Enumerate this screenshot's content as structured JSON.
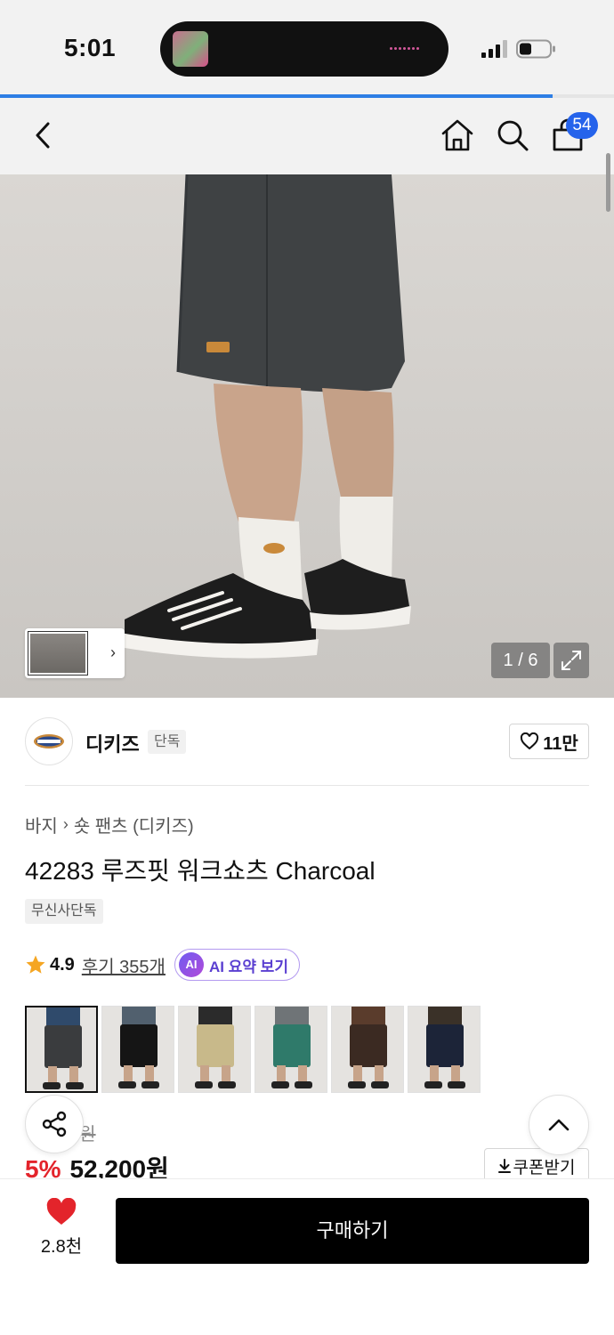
{
  "status": {
    "time": "5:01"
  },
  "cart": {
    "badge": "54"
  },
  "gallery": {
    "counter": "1 / 6"
  },
  "brand": {
    "name": "디키즈",
    "tag": "단독",
    "likes": "11만"
  },
  "breadcrumb": {
    "category": "바지",
    "subcategory": "숏 팬츠 (디키즈)"
  },
  "product": {
    "title": "42283 루즈핏 워크쇼츠 Charcoal",
    "exclusive_tag": "무신사단독",
    "rating": "4.9",
    "reviews": "후기 355개",
    "ai_badge": "AI",
    "ai_summary": "AI 요약 보기",
    "original_price_fragment": "원",
    "discount": "5%",
    "price": "52,200원",
    "coupon": "쿠폰받기"
  },
  "color_options": [
    {
      "name": "charcoal",
      "color": "#3a3c3e",
      "top": "#2f4a6b",
      "selected": true
    },
    {
      "name": "black",
      "color": "#151515",
      "top": "#51606e",
      "selected": false
    },
    {
      "name": "khaki",
      "color": "#c8b98a",
      "top": "#2b2b2b",
      "selected": false
    },
    {
      "name": "green",
      "color": "#2f7a6a",
      "top": "#6f7477",
      "selected": false
    },
    {
      "name": "brown",
      "color": "#3b2a22",
      "top": "#5a3c2c",
      "selected": false
    },
    {
      "name": "navy",
      "color": "#1c2438",
      "top": "#3a3128",
      "selected": false
    }
  ],
  "bottom": {
    "fav_count": "2.8천",
    "buy_label": "구매하기"
  },
  "colors": {
    "accent_blue": "#2563eb",
    "discount_red": "#e3242b",
    "heart_red": "#e3242b"
  },
  "page_progress": 0.9
}
